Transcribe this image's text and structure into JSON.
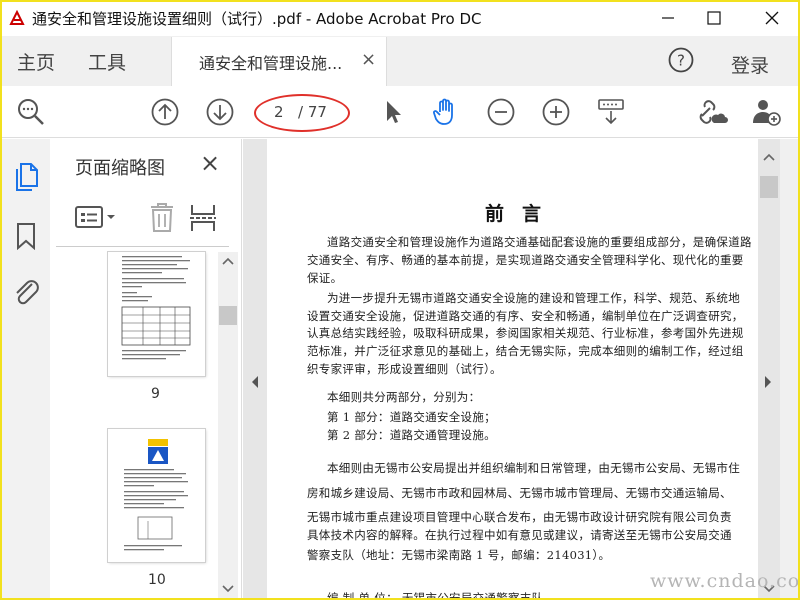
{
  "window": {
    "title": "通安全和管理设施设置细则（试行）.pdf - Adobe Acrobat Pro DC",
    "controls": [
      "minimize",
      "maximize",
      "close"
    ]
  },
  "menu": {
    "home": "主页",
    "tools": "工具",
    "doc_tab": "通安全和管理设施...",
    "doc_tab_close": "×",
    "help": "?",
    "login": "登录"
  },
  "toolbar": {
    "page_current": "2",
    "page_total": "/ 77",
    "icons": [
      "search-zoom-icon",
      "page-up-icon",
      "page-down-icon",
      "select-arrow-icon",
      "hand-tool-icon",
      "zoom-out-icon",
      "zoom-in-icon",
      "keyboard-dropdown-icon",
      "link-cloud-icon",
      "add-user-icon"
    ],
    "hand_color": "#1a73e8",
    "annotation_color": "#e0302a"
  },
  "sidebar": {
    "panel_title": "页面缩略图",
    "panel_close": "×",
    "thumbnails": [
      {
        "label": "9"
      },
      {
        "label": "10"
      }
    ]
  },
  "document": {
    "heading": "前言",
    "paragraphs": [
      "道路交通安全和管理设施作为道路交通基础配套设施的重要组成部分，是确保道路",
      "交通安全、有序、畅通的基本前提，是实现道路交通安全管理科学化、现代化的重要",
      "保证。",
      "为进一步提升无锡市道路交通安全设施的建设和管理工作，科学、规范、系统地",
      "设置交通安全设施，促进道路交通的有序、安全和畅通，编制单位在广泛调查研究，",
      "认真总结实践经验，吸取科研成果，参阅国家相关规范、行业标准，参考国外先进规",
      "范标准，并广泛征求意见的基础上，结合无锡实际，完成本细则的编制工作，经过组",
      "织专家评审，形成设置细则（试行）。",
      "本细则共分两部分，分别为：",
      "第 1 部分：道路交通安全设施；",
      "第 2 部分：道路交通管理设施。",
      "本细则由无锡市公安局提出并组织编制和日常管理，由无锡市公安局、无锡市住",
      "房和城乡建设局、无锡市市政和园林局、无锡市城市管理局、无锡市交通运输局、",
      "无锡市城市重点建设项目管理中心联合发布，由无锡市政设计研究院有限公司负责",
      "具体技术内容的解释。在执行过程中如有意见或建议，请寄送至无锡市公安局交通",
      "警察支队（地址：无锡市梁南路 1 号，邮编：214031）。",
      "编 制 单 位：    无锡市公安局交通警察支队"
    ]
  },
  "watermark": "www.cndao.com"
}
